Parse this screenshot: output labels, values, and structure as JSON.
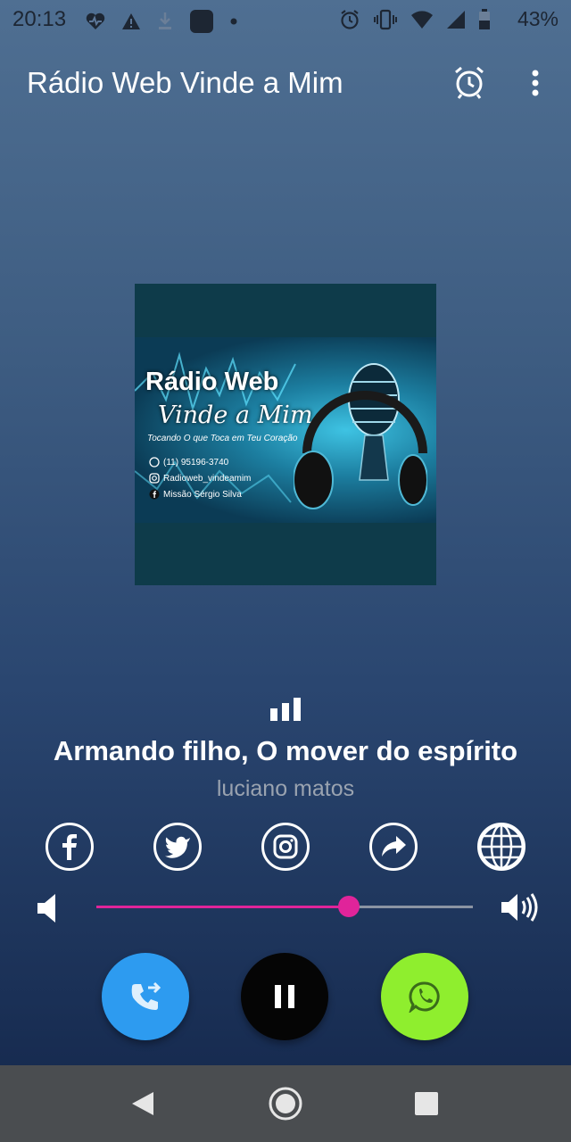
{
  "status_bar": {
    "time": "20:13",
    "battery": "43%"
  },
  "app_bar": {
    "title": "Rádio Web Vinde a Mim"
  },
  "cover": {
    "line1": "Rádio Web",
    "line2": "Vinde a Mim",
    "tagline": "Tocando O que Toca em Teu Coração",
    "phone": "(11) 95196-3740",
    "instagram": "Radioweb_vindeamim",
    "facebook": "Missão Sérgio Silva"
  },
  "now_playing": {
    "song": "Armando filho, O mover do espírito",
    "artist": "luciano matos"
  },
  "social_icons": [
    "facebook-icon",
    "twitter-icon",
    "instagram-icon",
    "share-icon",
    "globe-icon"
  ],
  "volume": {
    "level": 0.67
  },
  "colors": {
    "accent": "#e0249a",
    "call_button": "#2d9bf0",
    "whatsapp_button": "#8fee2e",
    "pause_button": "#050505"
  }
}
